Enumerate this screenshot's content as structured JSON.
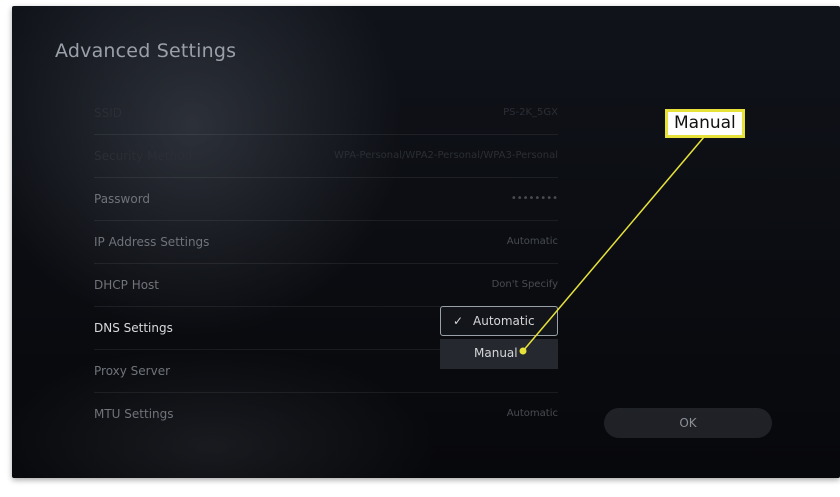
{
  "page": {
    "title": "Advanced Settings"
  },
  "settings": [
    {
      "label": "SSID",
      "value": "PS-2K_5GX",
      "state": "dim"
    },
    {
      "label": "Security Method",
      "value": "WPA-Personal/WPA2-Personal/WPA3-Personal",
      "state": "dim"
    },
    {
      "label": "Password",
      "value": "••••••••",
      "state": "mid"
    },
    {
      "label": "IP Address Settings",
      "value": "Automatic",
      "state": "mid"
    },
    {
      "label": "DHCP Host",
      "value": "Don't Specify",
      "state": "mid"
    },
    {
      "label": "DNS Settings",
      "value": "",
      "state": "focused"
    },
    {
      "label": "Proxy Server",
      "value": "",
      "state": "mid"
    },
    {
      "label": "MTU Settings",
      "value": "Automatic",
      "state": "mid"
    }
  ],
  "dropdown": {
    "check_glyph": "✓",
    "options": [
      {
        "label": "Automatic"
      },
      {
        "label": "Manual"
      }
    ]
  },
  "ok_button": {
    "label": "OK"
  },
  "annotation": {
    "label": "Manual",
    "color": "#e6e23a"
  }
}
